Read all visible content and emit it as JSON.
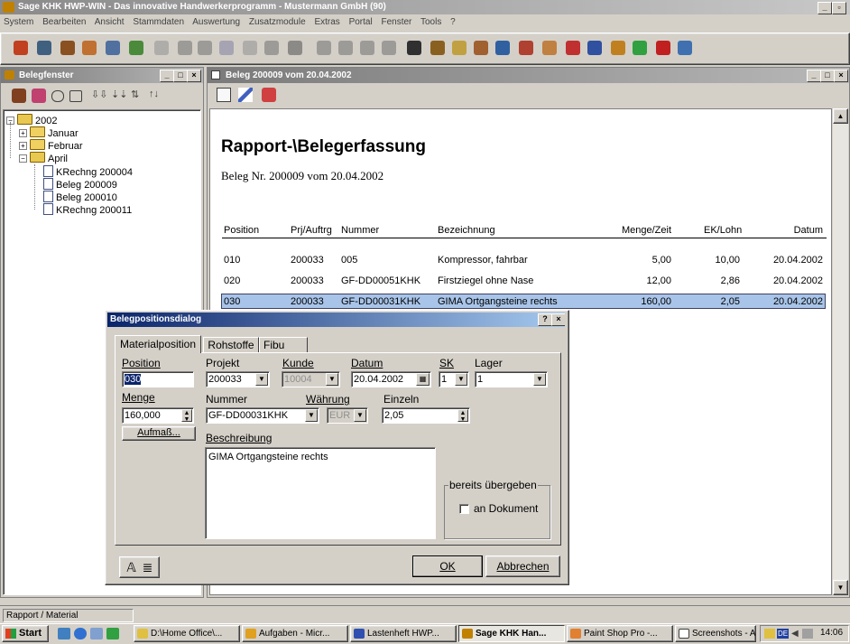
{
  "app": {
    "title": "Sage KHK HWP-WIN - Das innovative Handwerkerprogramm - Mustermann GmbH (90)",
    "menu": [
      "System",
      "Bearbeiten",
      "Ansicht",
      "Stammdaten",
      "Auswertung",
      "Zusatzmodule",
      "Extras",
      "Portal",
      "Fenster",
      "Tools",
      "?"
    ]
  },
  "icons": {
    "toolbar": [
      "flag-icon",
      "user-card-icon",
      "clock-icon",
      "tools-icon",
      "people-icon",
      "calc-icon",
      "print-icon",
      "cut-icon",
      "copy-icon",
      "paste-icon",
      "undo-icon",
      "n-icon",
      "delete-icon",
      "first-icon",
      "prev-icon",
      "next-icon",
      "last-icon",
      "help-icon",
      "crowd-icon",
      "lamp-icon",
      "tablet-icon",
      "book-icon",
      "bookshelf-icon",
      "sign-icon",
      "car-icon",
      "people-group-icon",
      "pen-icon",
      "grid-icon",
      "red-book-icon",
      "globe-icon"
    ],
    "colors": {
      "titlebar_active": "#0a246a",
      "selection": "#0a246a",
      "desktop": "#d4d0c8"
    }
  },
  "left": {
    "title": "Belegfenster",
    "tree": {
      "year": "2002",
      "months": [
        "Januar",
        "Februar",
        "April"
      ],
      "docs": [
        "KRechng 200004",
        "Beleg 200009",
        "Beleg 200010",
        "KRechng 200011"
      ]
    }
  },
  "right": {
    "title": "Beleg 200009 vom 20.04.2002",
    "heading": "Rapport-\\Belegerfassung",
    "sub": "Beleg Nr. 200009 vom  20.04.2002",
    "columns": [
      "Position",
      "Prj/Auftrg",
      "Nummer",
      "Bezeichnung",
      "Menge/Zeit",
      "EK/Lohn",
      "Datum"
    ],
    "rows": [
      [
        "010",
        "200033",
        "005",
        "Kompressor, fahrbar",
        "5,00",
        "10,00",
        "20.04.2002"
      ],
      [
        "020",
        "200033",
        "GF-DD00051KHK",
        "Firstziegel ohne Nase",
        "12,00",
        "2,86",
        "20.04.2002"
      ],
      [
        "030",
        "200033",
        "GF-DD00031KHK",
        "GIMA Ortgangsteine rechts",
        "160,00",
        "2,05",
        "20.04.2002"
      ]
    ]
  },
  "dialog": {
    "title": "Belegpositionsdialog",
    "help": "?",
    "close": "×",
    "tabs": [
      "Materialposition",
      "Rohstoffe",
      "Fibu"
    ],
    "labels": {
      "position": "Position",
      "projekt": "Projekt",
      "kunde": "Kunde",
      "datum": "Datum",
      "sk": "SK",
      "lager": "Lager",
      "menge": "Menge",
      "nummer": "Nummer",
      "waehrung": "Währung",
      "einzeln": "Einzeln",
      "beschreibung": "Beschreibung",
      "bereits": "bereits übergeben",
      "an_dokument": "an Dokument"
    },
    "values": {
      "position": "030",
      "projekt": "200033",
      "kunde": "10004",
      "datum": "20.04.2002",
      "sk": "1",
      "lager": "1",
      "menge": "160,000",
      "nummer": "GF-DD00031KHK",
      "waehrung": "EUR",
      "einzeln": "2,05",
      "beschreibung": "GIMA Ortgangsteine rechts"
    },
    "buttons": {
      "aufmass": "Aufmaß...",
      "ok": "OK",
      "abbrechen": "Abbrechen"
    }
  },
  "status": "Rapport / Material",
  "taskbar": {
    "start": "Start",
    "tasks": [
      "D:\\Home Office\\...",
      "Aufgaben - Micr...",
      "Lastenheft HWP...",
      "Sage KHK Han...",
      "Paint Shop Pro -...",
      "Screenshots - A..."
    ],
    "tray_lang": "DE",
    "time": "14:06"
  }
}
